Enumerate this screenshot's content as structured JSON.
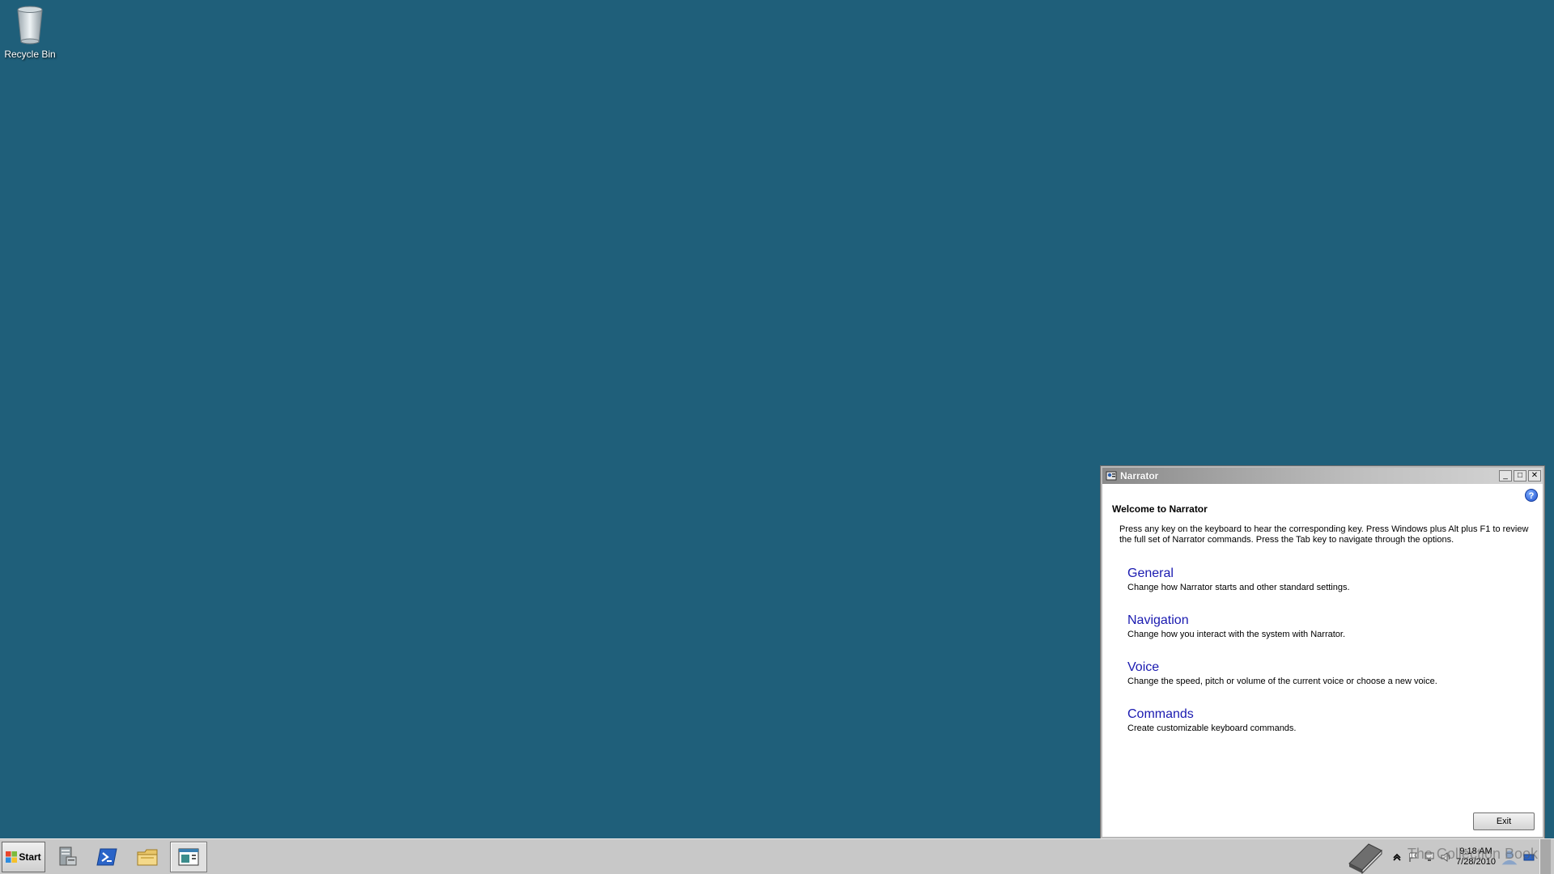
{
  "desktop": {
    "icons": [
      {
        "label": "Recycle Bin",
        "icon": "recycle-bin-icon"
      }
    ]
  },
  "narrator": {
    "title": "Narrator",
    "controls": {
      "minimize": "_",
      "maximize": "□",
      "close": "✕"
    },
    "help": "?",
    "heading": "Welcome to Narrator",
    "intro": "Press any key on the keyboard to hear the corresponding key. Press Windows plus Alt plus F1 to review the full set of Narrator commands. Press the Tab key to navigate through the options.",
    "options": [
      {
        "label": "General",
        "description": "Change how Narrator starts and other standard settings."
      },
      {
        "label": "Navigation",
        "description": "Change how you interact with the system with Narrator."
      },
      {
        "label": "Voice",
        "description": "Change the speed, pitch or volume of the current voice or choose a new voice."
      },
      {
        "label": "Commands",
        "description": "Create customizable keyboard commands."
      }
    ],
    "exit_label": "Exit"
  },
  "taskbar": {
    "start_label": "Start",
    "pinned": [
      {
        "name": "server-manager-icon"
      },
      {
        "name": "powershell-icon"
      },
      {
        "name": "explorer-folder-icon"
      },
      {
        "name": "narrator-window-icon",
        "active": true
      }
    ],
    "tray": {
      "time": "9:18 AM",
      "date": "7/28/2010",
      "watermark": "The Collection Book"
    }
  },
  "colors": {
    "desktop_bg": "#1f5f7a",
    "link": "#1a1ab0",
    "taskbar": "#c8c8c8"
  }
}
